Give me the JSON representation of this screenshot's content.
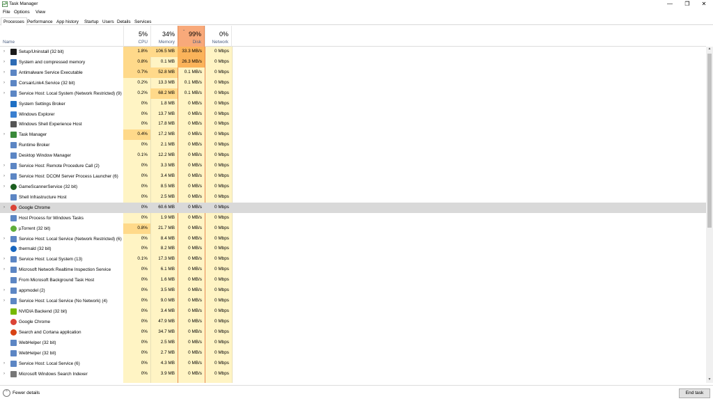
{
  "window": {
    "title": "Task Manager",
    "minimize": "—",
    "maximize": "❐",
    "close": "✕"
  },
  "menu": [
    "File",
    "Options",
    "View"
  ],
  "tabs": [
    "Processes",
    "Performance",
    "App history",
    "Startup",
    "Users",
    "Details",
    "Services"
  ],
  "header": {
    "name": "Name",
    "cpu": {
      "pct": "5%",
      "label": "CPU"
    },
    "memory": {
      "pct": "34%",
      "label": "Memory"
    },
    "disk": {
      "pct": "99%",
      "label": "Disk"
    },
    "network": {
      "pct": "0%",
      "label": "Network"
    }
  },
  "colors": {
    "heat_low": "#fff4c4",
    "heat_mid": "#ffd98a",
    "heat_high": "#fbb35a",
    "disk_header": "#f8a97a",
    "selected": "#d9d9d9"
  },
  "rows": [
    {
      "name": "Setup/Uninstall (32 bit)",
      "cpu": "1.8%",
      "mem": "106.5 MB",
      "disk": "33.3 MB/s",
      "net": "0 Mbps",
      "expand": true,
      "icon": "setup-icon",
      "iconColor": "#1a1a1a",
      "heat": {
        "cpu": "mid",
        "mem": "mid",
        "disk": "high"
      }
    },
    {
      "name": "System and compressed memory",
      "cpu": "0.8%",
      "mem": "0.1 MB",
      "disk": "26.3 MB/s",
      "net": "0 Mbps",
      "expand": true,
      "icon": "system-icon",
      "iconColor": "#2d6bb5",
      "heat": {
        "cpu": "mid",
        "disk": "high"
      }
    },
    {
      "name": "Antimalware Service Executable",
      "cpu": "0.7%",
      "mem": "52.8 MB",
      "disk": "0.1 MB/s",
      "net": "0 Mbps",
      "expand": true,
      "icon": "service-icon",
      "iconColor": "#5c86c4",
      "heat": {
        "cpu": "mid",
        "mem": "mid"
      }
    },
    {
      "name": "CorsairLink4.Service (32 bit)",
      "cpu": "0.2%",
      "mem": "13.3 MB",
      "disk": "0.1 MB/s",
      "net": "0 Mbps",
      "expand": true,
      "icon": "service-icon",
      "iconColor": "#5c86c4",
      "heat": {}
    },
    {
      "name": "Service Host: Local System (Network Restricted) (9)",
      "cpu": "0.2%",
      "mem": "68.2 MB",
      "disk": "0.1 MB/s",
      "net": "0 Mbps",
      "expand": true,
      "icon": "gear-icon",
      "iconColor": "#5c86c4",
      "heat": {
        "mem": "mid"
      }
    },
    {
      "name": "System Settings Broker",
      "cpu": "0%",
      "mem": "1.8 MB",
      "disk": "0 MB/s",
      "net": "0 Mbps",
      "expand": false,
      "icon": "settings-icon",
      "iconColor": "#1e6fc4",
      "heat": {}
    },
    {
      "name": "Windows Explorer",
      "cpu": "0%",
      "mem": "13.7 MB",
      "disk": "0 MB/s",
      "net": "0 Mbps",
      "expand": false,
      "icon": "explorer-icon",
      "iconColor": "#3a7fd0",
      "heat": {}
    },
    {
      "name": "Windows Shell Experience Host",
      "cpu": "0%",
      "mem": "17.8 MB",
      "disk": "0 MB/s",
      "net": "0 Mbps",
      "expand": false,
      "icon": "shell-icon",
      "iconColor": "#555555",
      "heat": {}
    },
    {
      "name": "Task Manager",
      "cpu": "0.4%",
      "mem": "17.2 MB",
      "disk": "0 MB/s",
      "net": "0 Mbps",
      "expand": true,
      "icon": "taskmanager-icon",
      "iconColor": "#3a8a3a",
      "heat": {
        "cpu": "mid"
      }
    },
    {
      "name": "Runtime Broker",
      "cpu": "0%",
      "mem": "2.1 MB",
      "disk": "0 MB/s",
      "net": "0 Mbps",
      "expand": false,
      "icon": "service-icon",
      "iconColor": "#5c86c4",
      "heat": {}
    },
    {
      "name": "Desktop Window Manager",
      "cpu": "0.1%",
      "mem": "12.2 MB",
      "disk": "0 MB/s",
      "net": "0 Mbps",
      "expand": false,
      "icon": "service-icon",
      "iconColor": "#5c86c4",
      "heat": {}
    },
    {
      "name": "Service Host: Remote Procedure Call (2)",
      "cpu": "0%",
      "mem": "3.3 MB",
      "disk": "0 MB/s",
      "net": "0 Mbps",
      "expand": true,
      "icon": "gear-icon",
      "iconColor": "#5c86c4",
      "heat": {}
    },
    {
      "name": "Service Host: DCOM Server Process Launcher (6)",
      "cpu": "0%",
      "mem": "3.4 MB",
      "disk": "0 MB/s",
      "net": "0 Mbps",
      "expand": true,
      "icon": "gear-icon",
      "iconColor": "#5c86c4",
      "heat": {}
    },
    {
      "name": "GameScannerService (32 bit)",
      "cpu": "0%",
      "mem": "8.5 MB",
      "disk": "0 MB/s",
      "net": "0 Mbps",
      "expand": true,
      "icon": "game-scanner-icon",
      "iconColor": "#1b5e20",
      "heat": {}
    },
    {
      "name": "Shell Infrastructure Host",
      "cpu": "0%",
      "mem": "2.5 MB",
      "disk": "0 MB/s",
      "net": "0 Mbps",
      "expand": false,
      "icon": "service-icon",
      "iconColor": "#5c86c4",
      "heat": {}
    },
    {
      "name": "Google Chrome",
      "cpu": "0%",
      "mem": "60.6 MB",
      "disk": "0 MB/s",
      "net": "0 Mbps",
      "expand": true,
      "icon": "chrome-icon",
      "iconColor": "#db4437",
      "selected": true,
      "heat": {}
    },
    {
      "name": "Host Process for Windows Tasks",
      "cpu": "0%",
      "mem": "1.9 MB",
      "disk": "0 MB/s",
      "net": "0 Mbps",
      "expand": false,
      "icon": "service-icon",
      "iconColor": "#5c86c4",
      "heat": {}
    },
    {
      "name": "µTorrent (32 bit)",
      "cpu": "0.8%",
      "mem": "21.7 MB",
      "disk": "0 MB/s",
      "net": "0 Mbps",
      "expand": false,
      "icon": "utorrent-icon",
      "iconColor": "#5fae3a",
      "heat": {
        "cpu": "mid"
      }
    },
    {
      "name": "Service Host: Local Service (Network Restricted) (6)",
      "cpu": "0%",
      "mem": "8.4 MB",
      "disk": "0 MB/s",
      "net": "0 Mbps",
      "expand": true,
      "icon": "gear-icon",
      "iconColor": "#5c86c4",
      "heat": {}
    },
    {
      "name": "thermald (32 bit)",
      "cpu": "0%",
      "mem": "8.2 MB",
      "disk": "0 MB/s",
      "net": "0 Mbps",
      "expand": false,
      "icon": "thermald-icon",
      "iconColor": "#1565c0",
      "heat": {}
    },
    {
      "name": "Service Host: Local System (13)",
      "cpu": "0.1%",
      "mem": "17.3 MB",
      "disk": "0 MB/s",
      "net": "0 Mbps",
      "expand": true,
      "icon": "gear-icon",
      "iconColor": "#5c86c4",
      "heat": {}
    },
    {
      "name": "Microsoft Network Realtime Inspection Service",
      "cpu": "0%",
      "mem": "6.1 MB",
      "disk": "0 MB/s",
      "net": "0 Mbps",
      "expand": true,
      "icon": "service-icon",
      "iconColor": "#5c86c4",
      "heat": {}
    },
    {
      "name": "From Microsoft Background Task Host",
      "cpu": "0%",
      "mem": "1.6 MB",
      "disk": "0 MB/s",
      "net": "0 Mbps",
      "expand": false,
      "icon": "service-icon",
      "iconColor": "#5c86c4",
      "heat": {}
    },
    {
      "name": "appmodel (2)",
      "cpu": "0%",
      "mem": "3.5 MB",
      "disk": "0 MB/s",
      "net": "0 Mbps",
      "expand": true,
      "icon": "gear-icon",
      "iconColor": "#5c86c4",
      "heat": {}
    },
    {
      "name": "Service Host: Local Service (No Network) (4)",
      "cpu": "0%",
      "mem": "9.0 MB",
      "disk": "0 MB/s",
      "net": "0 Mbps",
      "expand": true,
      "icon": "gear-icon",
      "iconColor": "#5c86c4",
      "heat": {}
    },
    {
      "name": "NVIDIA Backend (32 bit)",
      "cpu": "0%",
      "mem": "3.4 MB",
      "disk": "0 MB/s",
      "net": "0 Mbps",
      "expand": false,
      "icon": "nvidia-icon",
      "iconColor": "#76b900",
      "heat": {}
    },
    {
      "name": "Google Chrome",
      "cpu": "0%",
      "mem": "47.9 MB",
      "disk": "0 MB/s",
      "net": "0 Mbps",
      "expand": false,
      "icon": "chrome-icon",
      "iconColor": "#db4437",
      "heat": {}
    },
    {
      "name": "Search and Cortana application",
      "cpu": "0%",
      "mem": "34.7 MB",
      "disk": "0 MB/s",
      "net": "0 Mbps",
      "expand": false,
      "icon": "cortana-icon",
      "iconColor": "#d84315",
      "heat": {}
    },
    {
      "name": "WebHelper (32 bit)",
      "cpu": "0%",
      "mem": "2.5 MB",
      "disk": "0 MB/s",
      "net": "0 Mbps",
      "expand": false,
      "icon": "service-icon",
      "iconColor": "#5c86c4",
      "heat": {}
    },
    {
      "name": "WebHelper (32 bit)",
      "cpu": "0%",
      "mem": "2.7 MB",
      "disk": "0 MB/s",
      "net": "0 Mbps",
      "expand": false,
      "icon": "service-icon",
      "iconColor": "#5c86c4",
      "heat": {}
    },
    {
      "name": "Service Host: Local Service (6)",
      "cpu": "0%",
      "mem": "4.3 MB",
      "disk": "0 MB/s",
      "net": "0 Mbps",
      "expand": true,
      "icon": "gear-icon",
      "iconColor": "#5c86c4",
      "heat": {}
    },
    {
      "name": "Microsoft Windows Search Indexer",
      "cpu": "0%",
      "mem": "3.9 MB",
      "disk": "0 MB/s",
      "net": "0 Mbps",
      "expand": true,
      "icon": "search-indexer-icon",
      "iconColor": "#777777",
      "heat": {}
    }
  ],
  "footer": {
    "fewer_details": "Fewer details",
    "end_task": "End task"
  }
}
